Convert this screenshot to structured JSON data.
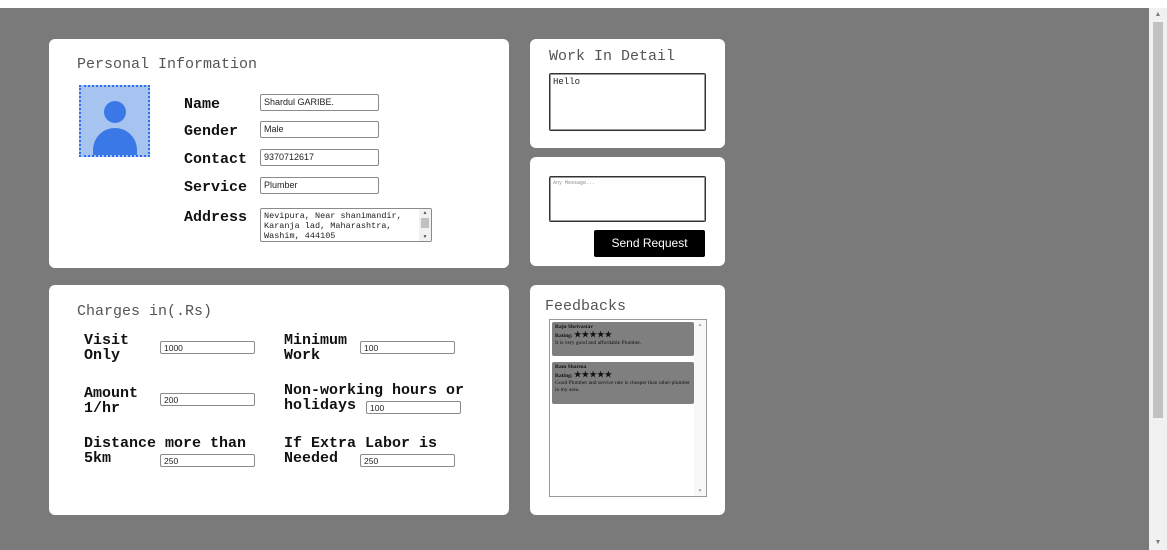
{
  "personal": {
    "title": "Personal Information",
    "labels": {
      "name": "Name",
      "gender": "Gender",
      "contact": "Contact",
      "service": "Service",
      "address": "Address"
    },
    "values": {
      "name": "Shardul GARIBE.",
      "gender": "Male",
      "contact": "9370712617",
      "service": "Plumber",
      "address": "Nevipura, Near shanimandir, Karanja lad, Maharashtra, Washim, 444105"
    },
    "avatar_icon": "user-avatar-icon"
  },
  "charges": {
    "title": "Charges in(.Rs)",
    "fields": {
      "visit_only": {
        "label": "Visit Only",
        "value": "1000"
      },
      "minimum_work": {
        "label": "Minimum Work",
        "value": "100"
      },
      "amount_per_hr": {
        "label": "Amount 1/hr",
        "value": "200"
      },
      "non_working": {
        "label": "Non-working hours or holidays",
        "value": "100"
      },
      "distance": {
        "label": "Distance more than 5km",
        "value": "250"
      },
      "extra_labor": {
        "label": "If Extra Labor is Needed",
        "value": "250"
      }
    }
  },
  "work": {
    "title": "Work In Detail",
    "value": "Hello"
  },
  "message": {
    "placeholder": "Any Message...",
    "send_label": "Send Request"
  },
  "feedbacks": {
    "title": "Feedbacks",
    "items": [
      {
        "name": "Raju Shrivastav",
        "rating_label": "Rating:",
        "stars": "★★★★★",
        "comment": "It is very good and affordable Plumber."
      },
      {
        "name": "Ram Sharma",
        "rating_label": "Rating:",
        "stars": "★★★★★",
        "comment": "Good Plumber and service rate is cheaper than other plumber in my area."
      }
    ]
  },
  "colors": {
    "background": "#7a7a7a",
    "card": "#ffffff",
    "avatar_bg": "#a7c3f0",
    "avatar_fg": "#3b78e7",
    "button": "#000000",
    "feedback_item": "#7f7f7f"
  }
}
